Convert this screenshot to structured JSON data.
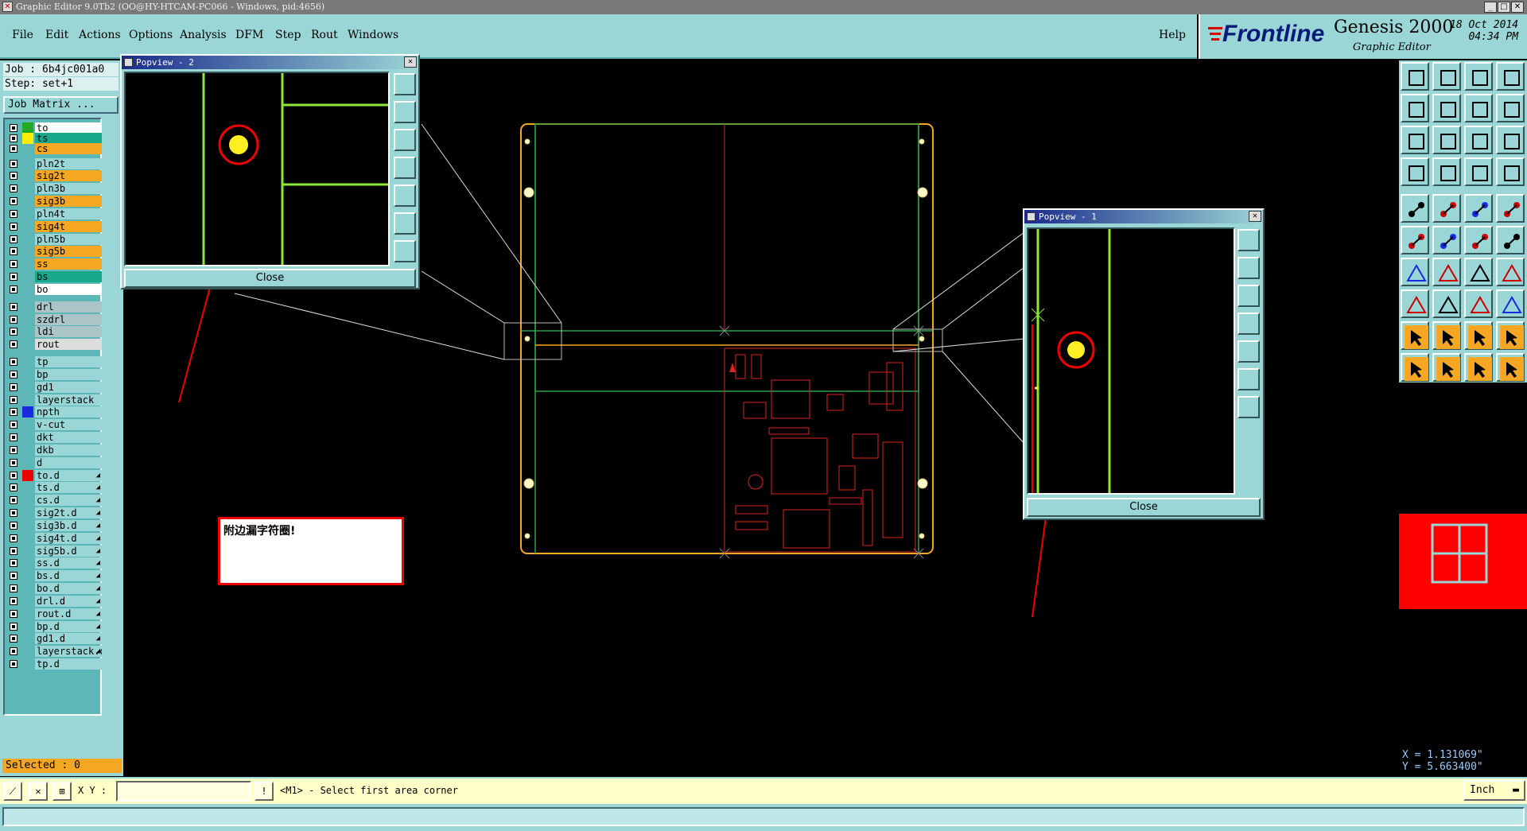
{
  "window": {
    "title": "Graphic Editor 9.0Tb2 (OO@HY-HTCAM-PC066 - Windows, pid:4656)"
  },
  "menu": [
    "File",
    "Edit",
    "Actions",
    "Options",
    "Analysis",
    "DFM",
    "Step",
    "Rout",
    "Windows"
  ],
  "help_label": "Help",
  "brand": {
    "logo_a": "Front",
    "logo_b": "line",
    "product": "Genesis 2000",
    "subtitle": "Graphic Editor",
    "date": "18 Oct 2014",
    "time": "04:34 PM"
  },
  "job": {
    "job_label": "Job : 6b4jc001a0",
    "step_label": "Step: set+1",
    "matrix_button": "Job Matrix ..."
  },
  "layers": [
    {
      "name": "to",
      "swatch": "#22aa22",
      "bg": "#ffffff",
      "drill": ""
    },
    {
      "name": "ts",
      "swatch": "#ffee00",
      "bg": "#1aa88a",
      "drill": ""
    },
    {
      "name": "cs",
      "swatch": "",
      "bg": "#f5a623",
      "drill": ""
    },
    {
      "name": "pln2t",
      "swatch": "",
      "bg": "#9bd6d6",
      "drill": ""
    },
    {
      "name": "sig2t",
      "swatch": "",
      "bg": "#f5a623",
      "drill": ""
    },
    {
      "name": "pln3b",
      "swatch": "",
      "bg": "#9bd6d6",
      "drill": ""
    },
    {
      "name": "sig3b",
      "swatch": "",
      "bg": "#f5a623",
      "drill": ""
    },
    {
      "name": "pln4t",
      "swatch": "",
      "bg": "#9bd6d6",
      "drill": ""
    },
    {
      "name": "sig4t",
      "swatch": "",
      "bg": "#f5a623",
      "drill": ""
    },
    {
      "name": "pln5b",
      "swatch": "",
      "bg": "#9bd6d6",
      "drill": ""
    },
    {
      "name": "sig5b",
      "swatch": "",
      "bg": "#f5a623",
      "drill": ""
    },
    {
      "name": "ss",
      "swatch": "",
      "bg": "#f5a623",
      "drill": ""
    },
    {
      "name": "bs",
      "swatch": "",
      "bg": "#1aa88a",
      "drill": ""
    },
    {
      "name": "bo",
      "swatch": "",
      "bg": "#ffffff",
      "drill": ""
    },
    {
      "name": "drl",
      "swatch": "",
      "bg": "#aac4c8",
      "drill": ""
    },
    {
      "name": "szdrl",
      "swatch": "",
      "bg": "#aac4c8",
      "drill": ""
    },
    {
      "name": "ldi",
      "swatch": "",
      "bg": "#aac4c8",
      "drill": ""
    },
    {
      "name": "rout",
      "swatch": "",
      "bg": "#dddddd",
      "drill": ""
    },
    {
      "name": "tp",
      "swatch": "",
      "bg": "#9bd6d6",
      "drill": ""
    },
    {
      "name": "bp",
      "swatch": "",
      "bg": "#9bd6d6",
      "drill": ""
    },
    {
      "name": "gd1",
      "swatch": "",
      "bg": "#9bd6d6",
      "drill": ""
    },
    {
      "name": "layerstack",
      "swatch": "",
      "bg": "#9bd6d6",
      "drill": ""
    },
    {
      "name": "npth",
      "swatch": "#1a2ae0",
      "bg": "#9bd6d6",
      "drill": ""
    },
    {
      "name": "v-cut",
      "swatch": "",
      "bg": "#9bd6d6",
      "drill": ""
    },
    {
      "name": "dkt",
      "swatch": "",
      "bg": "#9bd6d6",
      "drill": ""
    },
    {
      "name": "dkb",
      "swatch": "",
      "bg": "#9bd6d6",
      "drill": ""
    },
    {
      "name": "d",
      "swatch": "",
      "bg": "#9bd6d6",
      "drill": ""
    },
    {
      "name": "to.d",
      "swatch": "#ee0000",
      "bg": "#9bd6d6",
      "drill": "◢"
    },
    {
      "name": "ts.d",
      "swatch": "",
      "bg": "#9bd6d6",
      "drill": "◢"
    },
    {
      "name": "cs.d",
      "swatch": "",
      "bg": "#9bd6d6",
      "drill": "◢"
    },
    {
      "name": "sig2t.d",
      "swatch": "",
      "bg": "#9bd6d6",
      "drill": "◢"
    },
    {
      "name": "sig3b.d",
      "swatch": "",
      "bg": "#9bd6d6",
      "drill": "◢"
    },
    {
      "name": "sig4t.d",
      "swatch": "",
      "bg": "#9bd6d6",
      "drill": "◢"
    },
    {
      "name": "sig5b.d",
      "swatch": "",
      "bg": "#9bd6d6",
      "drill": "◢"
    },
    {
      "name": "ss.d",
      "swatch": "",
      "bg": "#9bd6d6",
      "drill": "◢"
    },
    {
      "name": "bs.d",
      "swatch": "",
      "bg": "#9bd6d6",
      "drill": "◢"
    },
    {
      "name": "bo.d",
      "swatch": "",
      "bg": "#9bd6d6",
      "drill": "◢"
    },
    {
      "name": "drl.d",
      "swatch": "",
      "bg": "#9bd6d6",
      "drill": "◢"
    },
    {
      "name": "rout.d",
      "swatch": "",
      "bg": "#9bd6d6",
      "drill": "◢"
    },
    {
      "name": "bp.d",
      "swatch": "",
      "bg": "#9bd6d6",
      "drill": "◢"
    },
    {
      "name": "gd1.d",
      "swatch": "",
      "bg": "#9bd6d6",
      "drill": "◢"
    },
    {
      "name": "layerstack.d",
      "swatch": "",
      "bg": "#9bd6d6",
      "drill": "◢"
    },
    {
      "name": "tp.d",
      "swatch": "",
      "bg": "#9bd6d6",
      "drill": ""
    }
  ],
  "selected_label": "Selected : 0",
  "status": {
    "xy_label": "X Y :",
    "xy_value": "",
    "prompt": "<M1> - Select first area corner"
  },
  "units": "Inch",
  "coords": {
    "x": "X = 1.131069\"",
    "y": "Y = 5.663400\""
  },
  "popview2": {
    "title": "Popview - 2",
    "close": "Close"
  },
  "popview1": {
    "title": "Popview - 1",
    "close": "Close"
  },
  "note": "附边漏字符圈!",
  "colors": {
    "panel": "#9bd6d6",
    "orange": "#f5a623",
    "trace_green": "#8ee83a",
    "circle_red": "#e00000",
    "pad_yellow": "#ffee22"
  }
}
